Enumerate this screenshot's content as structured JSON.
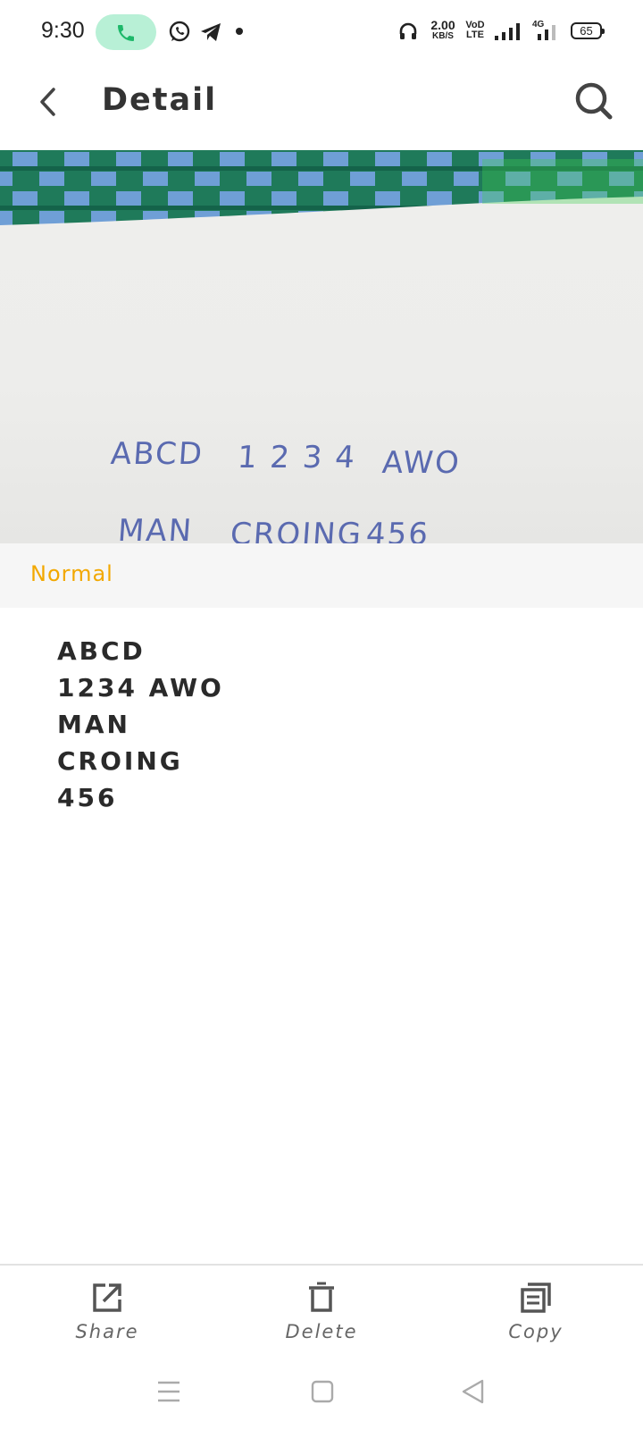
{
  "status_bar": {
    "time": "9:30",
    "speed_value": "2.00",
    "speed_unit": "KB/S",
    "volte_top": "VoD",
    "volte_bottom": "LTE",
    "network": "4G",
    "battery": "65",
    "icons": [
      "phone-call-icon",
      "whatsapp-icon",
      "telegram-icon",
      "headset-icon",
      "signal-icon",
      "battery-icon"
    ]
  },
  "header": {
    "title": "Detail",
    "back_icon": "chevron-left-icon",
    "search_icon": "search-icon"
  },
  "photo": {
    "handwritten_lines": [
      "ABCD",
      "1 2 3 4",
      "AWO",
      "MAN",
      "CROING",
      "456"
    ]
  },
  "mode": {
    "label": "Normal",
    "color": "#f2a800"
  },
  "result": {
    "lines": [
      "ABCD",
      "1234 AWO",
      "MAN",
      "CROING",
      "456"
    ]
  },
  "toolbar": {
    "share_label": "Share",
    "delete_label": "Delete",
    "copy_label": "Copy"
  },
  "navbar": {
    "icons": [
      "menu-icon",
      "home-icon",
      "back-triangle-icon"
    ]
  }
}
